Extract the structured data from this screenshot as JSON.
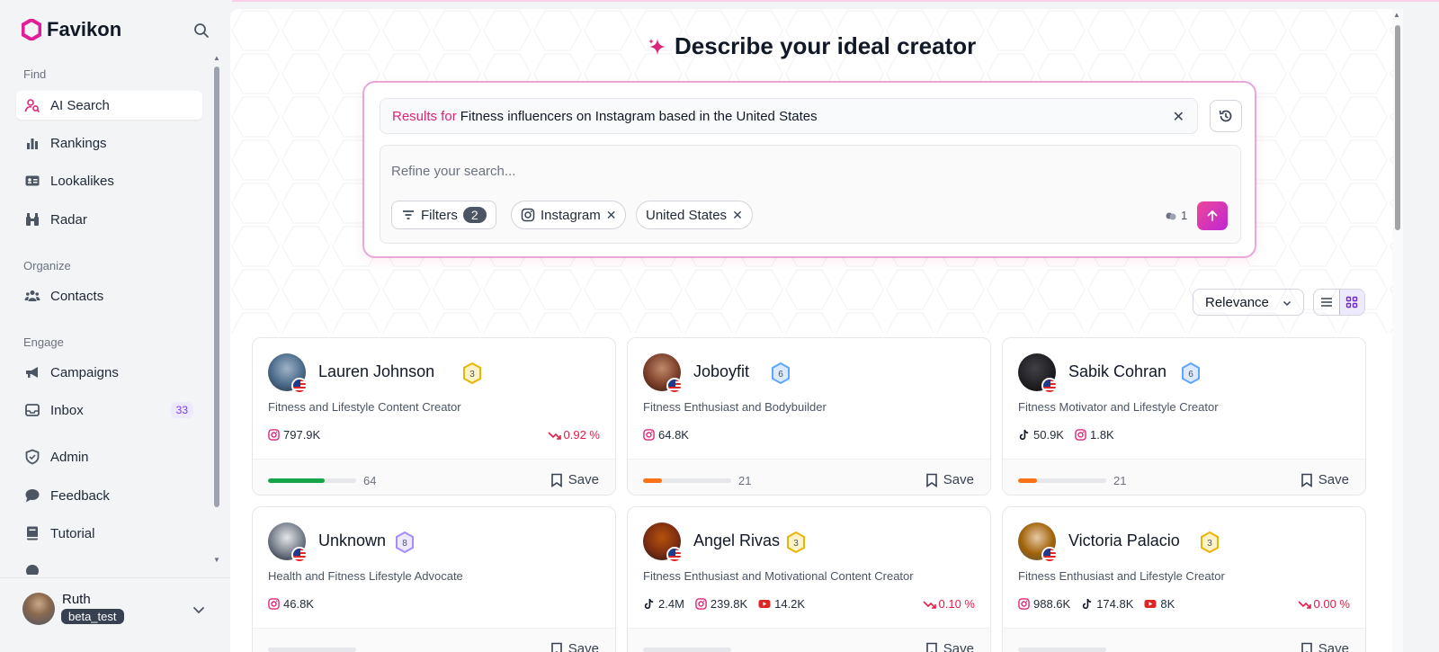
{
  "brand": {
    "name": "Favikon",
    "color": "#e11d9a"
  },
  "sidebar": {
    "sections": [
      {
        "label": "Find",
        "items": [
          {
            "label": "AI Search",
            "icon": "user-search-icon",
            "active": true
          },
          {
            "label": "Rankings",
            "icon": "bar-chart-icon"
          },
          {
            "label": "Lookalikes",
            "icon": "id-card-icon"
          },
          {
            "label": "Radar",
            "icon": "binoculars-icon"
          }
        ]
      },
      {
        "label": "Organize",
        "items": [
          {
            "label": "Contacts",
            "icon": "users-icon"
          }
        ]
      },
      {
        "label": "Engage",
        "items": [
          {
            "label": "Campaigns",
            "icon": "megaphone-icon"
          },
          {
            "label": "Inbox",
            "icon": "inbox-icon",
            "count": "33"
          }
        ]
      },
      {
        "label": "",
        "items": [
          {
            "label": "Admin",
            "icon": "shield-icon"
          },
          {
            "label": "Feedback",
            "icon": "chat-icon"
          },
          {
            "label": "Tutorial",
            "icon": "book-icon"
          }
        ]
      }
    ],
    "user": {
      "name": "Ruth",
      "tag": "beta_test"
    }
  },
  "heading": "Describe your ideal creator",
  "search": {
    "results_prefix": "Results for",
    "query": "Fitness influencers on Instagram based in the United States",
    "refine_placeholder": "Refine your search...",
    "filters_label": "Filters",
    "filters_count": "2",
    "chips": [
      "Instagram",
      "United States"
    ],
    "credits": "1"
  },
  "sort": {
    "selected": "Relevance"
  },
  "cards": [
    {
      "name": "Lauren Johnson",
      "level": "3",
      "level_color": "gold",
      "bio": "Fitness and Lifestyle Content Creator",
      "stats": [
        {
          "platform": "instagram",
          "value": "797.9K"
        }
      ],
      "trend": "0.92 %",
      "score": "64",
      "score_pct": 64,
      "bar_color": "#16a34a",
      "save": "Save"
    },
    {
      "name": "Joboyfit",
      "level": "6",
      "level_color": "blue",
      "bio": "Fitness Enthusiast and Bodybuilder",
      "stats": [
        {
          "platform": "instagram",
          "value": "64.8K"
        }
      ],
      "trend": "",
      "score": "21",
      "score_pct": 21,
      "bar_color": "#f97316",
      "save": "Save"
    },
    {
      "name": "Sabik Cohran",
      "level": "6",
      "level_color": "blue",
      "bio": "Fitness Motivator and Lifestyle Creator",
      "stats": [
        {
          "platform": "tiktok",
          "value": "50.9K"
        },
        {
          "platform": "instagram",
          "value": "1.8K"
        }
      ],
      "trend": "",
      "score": "21",
      "score_pct": 21,
      "bar_color": "#f97316",
      "save": "Save"
    },
    {
      "name": "Unknown",
      "level": "8",
      "level_color": "purple",
      "bio": "Health and Fitness Lifestyle Advocate",
      "stats": [
        {
          "platform": "instagram",
          "value": "46.8K"
        }
      ],
      "trend": "",
      "score": "",
      "score_pct": 0,
      "bar_color": "#f97316",
      "save": "Save"
    },
    {
      "name": "Angel Rivas",
      "level": "3",
      "level_color": "gold",
      "bio": "Fitness Enthusiast and Motivational Content Creator",
      "stats": [
        {
          "platform": "tiktok",
          "value": "2.4M"
        },
        {
          "platform": "instagram",
          "value": "239.8K"
        },
        {
          "platform": "youtube",
          "value": "14.2K"
        }
      ],
      "trend": "0.10 %",
      "score": "",
      "score_pct": 0,
      "bar_color": "#f97316",
      "save": "Save"
    },
    {
      "name": "Victoria Palacio",
      "level": "3",
      "level_color": "gold",
      "bio": "Fitness Enthusiast and Lifestyle Creator",
      "stats": [
        {
          "platform": "instagram",
          "value": "988.6K"
        },
        {
          "platform": "tiktok",
          "value": "174.8K"
        },
        {
          "platform": "youtube",
          "value": "8K"
        }
      ],
      "trend": "0.00 %",
      "score": "",
      "score_pct": 0,
      "bar_color": "#f97316",
      "save": "Save"
    }
  ]
}
